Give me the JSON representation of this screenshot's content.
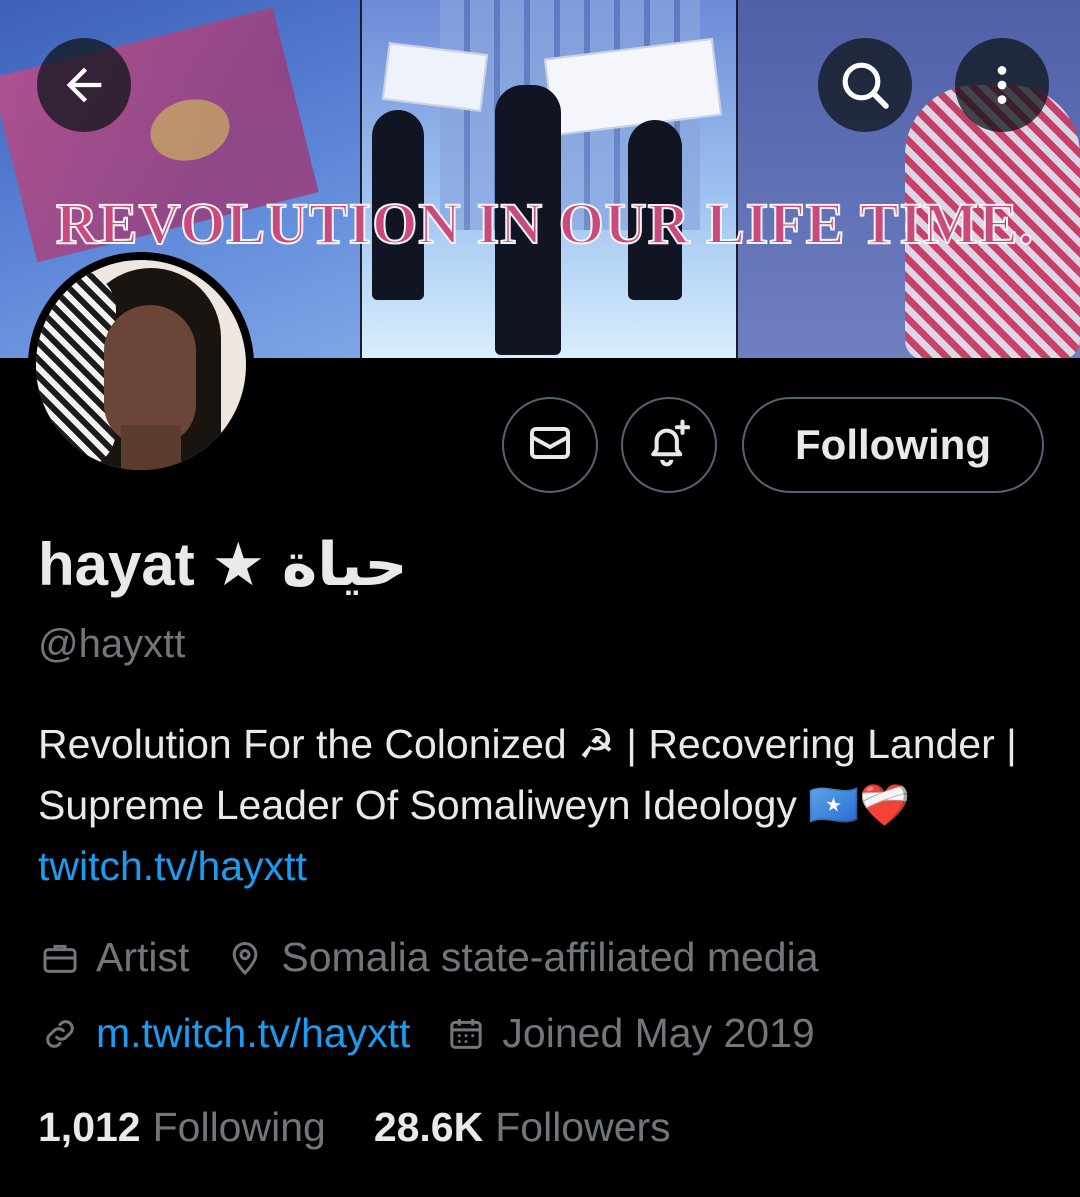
{
  "banner": {
    "text": "REVOLUTION IN OUR LIFE TIME."
  },
  "header": {
    "back_icon": "arrow-left-icon",
    "search_icon": "search-icon",
    "more_icon": "more-vertical-icon"
  },
  "actions": {
    "message_icon": "envelope-icon",
    "notify_icon": "bell-plus-icon",
    "following_label": "Following"
  },
  "profile": {
    "display_name": "hayat ★ حياة",
    "handle": "@hayxtt",
    "bio_text": "Revolution For the Colonized ☭ | Recovering Lander | Supreme Leader Of Somaliweyn Ideology 🇸🇴❤️‍🩹",
    "bio_link": "twitch.tv/hayxtt",
    "category": "Artist",
    "location": "Somalia state-affiliated media",
    "website": "m.twitch.tv/hayxtt",
    "joined": "Joined May 2019"
  },
  "stats": {
    "following_count": "1,012",
    "following_label": "Following",
    "followers_count": "28.6K",
    "followers_label": "Followers"
  },
  "colors": {
    "background": "#000000",
    "text_primary": "#e7e9ea",
    "text_secondary": "#71767b",
    "link": "#1d9bf0",
    "border": "#536471"
  }
}
